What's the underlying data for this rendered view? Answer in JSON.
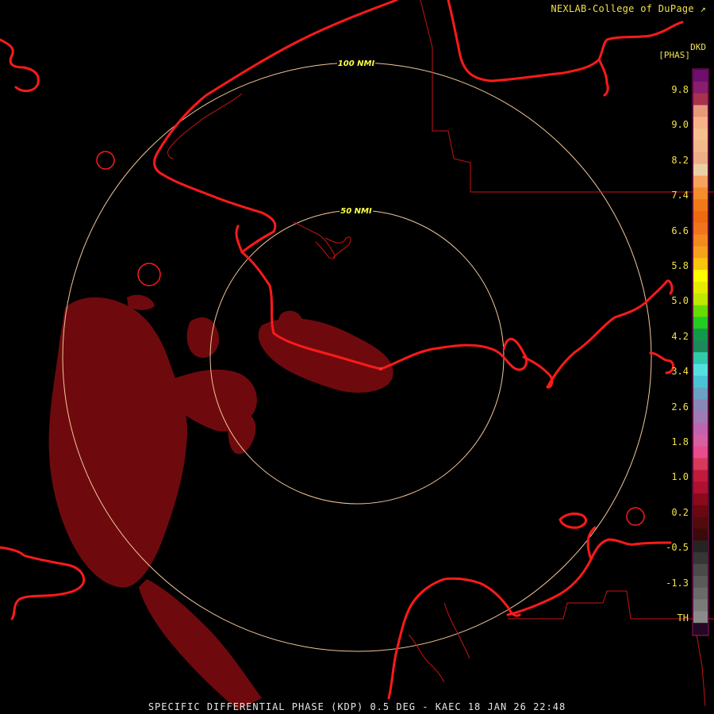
{
  "credit": "NEXLAB-College of DuPage",
  "product_code": "DKD",
  "unit": "[PHAS]",
  "footer": "SPECIFIC DIFFERENTIAL PHASE (KDP) 0.5 DEG - KAEC 18 JAN 26 22:48",
  "rings": [
    {
      "label": "100 NMI"
    },
    {
      "label": "50 NMI"
    }
  ],
  "scale_labels": [
    "9.8",
    "9.0",
    "8.2",
    "7.4",
    "6.6",
    "5.8",
    "5.0",
    "4.2",
    "3.4",
    "2.6",
    "1.8",
    "1.0",
    "0.2",
    "-0.5",
    "-1.3",
    "TH"
  ],
  "scale_colors": [
    "#6e0e6e",
    "#8a1e6e",
    "#a8324e",
    "#e69a7a",
    "#f7b388",
    "#f5c08c",
    "#f2b98a",
    "#eeae86",
    "#ecd0a5",
    "#f7a35c",
    "#f58d2c",
    "#f17a17",
    "#ee6a10",
    "#f0741b",
    "#f48a1e",
    "#f5a21b",
    "#f7c40e",
    "#ffff00",
    "#e6ec00",
    "#c0e800",
    "#66dd00",
    "#22cc22",
    "#129a4a",
    "#1a8a5a",
    "#31c9a9",
    "#55e0e0",
    "#4ac4d4",
    "#6aa2c4",
    "#8a86b6",
    "#a07ab4",
    "#c064b0",
    "#d660a0",
    "#e84c8c",
    "#d8385a",
    "#c21a3a",
    "#b01030",
    "#8a0a1a",
    "#6a0810",
    "#520a0a",
    "#3a0a0a",
    "#242424",
    "#363636",
    "#4a4a4a",
    "#5a5a5a",
    "#6a6a6a",
    "#7a7a7a",
    "#8a8a8a",
    "#240822"
  ],
  "colors": {
    "coast": "#ff1a1a",
    "ring": "#f2c79a",
    "echo": "#6e0a0e",
    "label": "#f2e04a"
  }
}
